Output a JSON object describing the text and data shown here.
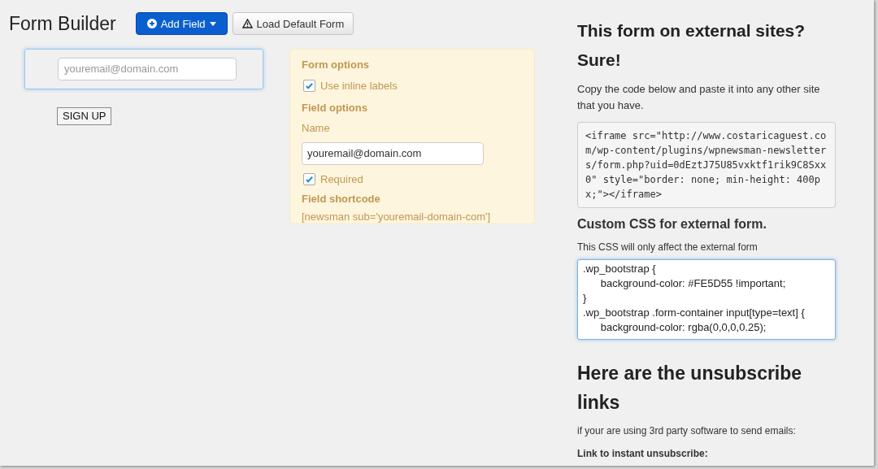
{
  "header": {
    "title": "Form Builder",
    "buttons": [
      {
        "kind": "primary",
        "label": "Add Field"
      },
      {
        "kind": "default",
        "label": "Load Default Form"
      }
    ]
  },
  "preview": {
    "email_placeholder": "youremail@domain.com",
    "submit": "SIGN UP",
    "selected": true
  },
  "options": {
    "form_heading": "Form options",
    "inline_labels": {
      "label": "Use inline labels",
      "checked": true
    },
    "field_heading": "Field options",
    "name_label": "Name",
    "name_value": "youremail@domain.com",
    "required": {
      "label": "Required",
      "checked": true
    },
    "shortcode_heading": "Field shortcode",
    "shortcode": "[newsman sub='youremail-domain-com']"
  },
  "external": {
    "title": "This form on external sites? Sure!",
    "intro": "Copy the code below and paste it into any other site that you have.",
    "code": "<iframe src=\"http://www.costaricaguest.com/wp-content/plugins/wpnewsman-newsletters/form.php?uid=0dEztJ75U85vxktf1rik9C8Sxx0\" style=\"border: none; min-height: 400px;\"></iframe>",
    "css_title": "Custom CSS for external form.",
    "css_note": "This CSS will only affect the external form",
    "css_lines": [
      ".wp_bootstrap {",
      "\tbackground-color: #FE5D55 !important;",
      "}",
      ".wp_bootstrap .form-container input[type=text] {",
      "\tbackground-color: rgba(0,0,0,0.25);"
    ],
    "unsub_title": "Here are the unsubscribe links",
    "unsub_note": "if your are using 3rd party software to send emails:",
    "unsub_link_label": "Link to instant unsubscribe:"
  }
}
